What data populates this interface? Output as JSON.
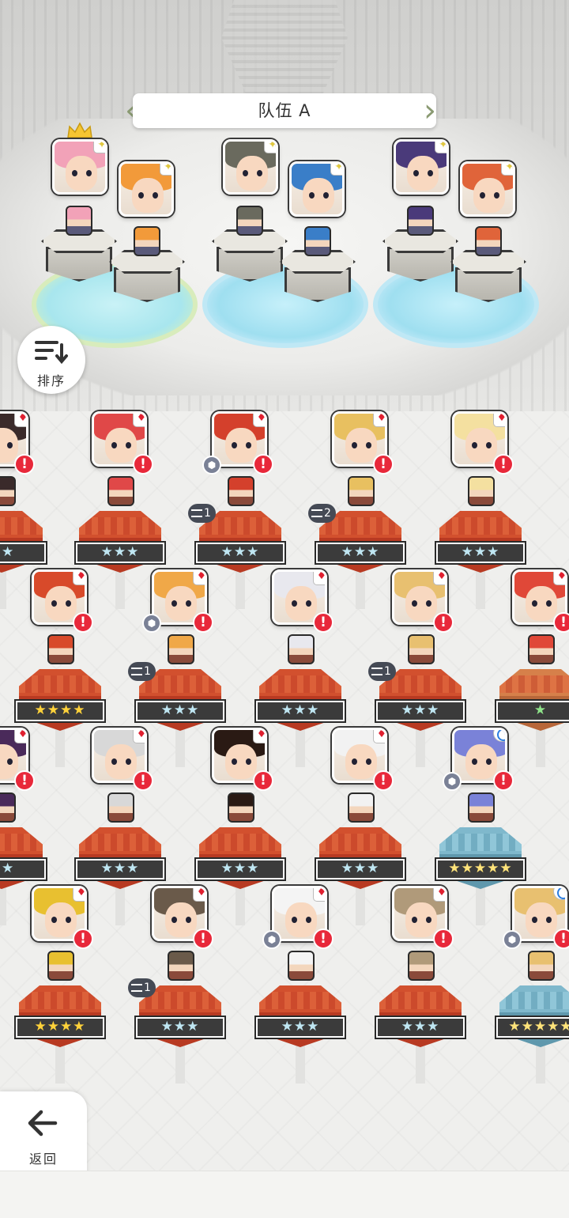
{
  "team": {
    "title": "队伍 A"
  },
  "sort_button": {
    "label": "排序",
    "icon": "sort-icon"
  },
  "back_button": {
    "label": "返回",
    "icon": "back-arrow-icon"
  },
  "colors": {
    "alert": "#e8283a",
    "accent_blue": "#2a7de0",
    "pedestal_red": "#d2502e",
    "crown_gold": "#f5c532"
  },
  "party": [
    {
      "slot": "leader",
      "badge": "sparkle-icon",
      "crowned": true,
      "hair": "#f2a2b8"
    },
    {
      "slot": "member-2",
      "badge": "sparkle-icon",
      "crowned": false,
      "hair": "#f29a3a"
    },
    {
      "slot": "member-3",
      "badge": "sparkle-icon",
      "crowned": false,
      "hair": "#6a6a5e"
    },
    {
      "slot": "member-4",
      "badge": "sparkle-icon",
      "crowned": false,
      "hair": "#3a7ec8"
    },
    {
      "slot": "member-5",
      "badge": "sparkle-icon",
      "crowned": false,
      "hair": "#4a3a7a"
    },
    {
      "slot": "member-6",
      "badge": "sparkle-icon",
      "crowned": false,
      "hair": "#e0643a"
    }
  ],
  "roster": [
    {
      "row": 1,
      "stars": "★★",
      "hair": "#3a2a2a"
    },
    {
      "row": 1,
      "stars": "★★★",
      "hair": "#e04848"
    },
    {
      "row": 1,
      "stars": "★★★",
      "hair": "#d4402c",
      "shield": true,
      "stack": "1"
    },
    {
      "row": 1,
      "stars": "★★★",
      "hair": "#e8c060",
      "stack": "2"
    },
    {
      "row": 1,
      "stars": "★★★",
      "hair": "#f4e0a0"
    },
    {
      "row": 2,
      "stars": "★★★★",
      "hair": "#d84a2a"
    },
    {
      "row": 2,
      "stars": "★★★",
      "hair": "#f0a848",
      "shield": true,
      "stack": "1"
    },
    {
      "row": 2,
      "stars": "★★★",
      "hair": "#e8e8ee"
    },
    {
      "row": 2,
      "stars": "★★★",
      "hair": "#e8c070",
      "stack": "1"
    },
    {
      "row": 2,
      "stars": "★",
      "hair": "#e04838"
    },
    {
      "row": 3,
      "stars": "★★",
      "hair": "#4a2a5a"
    },
    {
      "row": 3,
      "stars": "★★★",
      "hair": "#d8d8d8"
    },
    {
      "row": 3,
      "stars": "★★★",
      "hair": "#2a1a14"
    },
    {
      "row": 3,
      "stars": "★★★",
      "hair": "#f2f2f2"
    },
    {
      "row": 3,
      "stars": "★★★★★",
      "hair": "#7a82d8",
      "shield": true,
      "special": true
    },
    {
      "row": 4,
      "stars": "★★★★",
      "hair": "#e8c030"
    },
    {
      "row": 4,
      "stars": "★★★",
      "hair": "#6a5a4a",
      "stack": "1"
    },
    {
      "row": 4,
      "stars": "★★★",
      "hair": "#f4f4f4",
      "shield": true
    },
    {
      "row": 4,
      "stars": "★★★",
      "hair": "#b09a7a"
    },
    {
      "row": 4,
      "stars": "★★★★★",
      "hair": "#e8c070",
      "shield": true,
      "special": true
    }
  ],
  "symbols": {
    "suit": "♦",
    "alert": "!",
    "sparkle": "✦",
    "shield": "⬢"
  }
}
